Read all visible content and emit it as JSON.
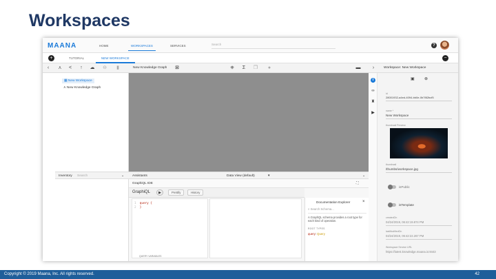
{
  "slide": {
    "title": "Workspaces",
    "footer_copyright": "Copyright © 2019 Maana, Inc.  All rights reserved.",
    "page_number": "42"
  },
  "app": {
    "logo": "MAANA",
    "nav": [
      "HOME",
      "WORKSPACES",
      "SERVICES"
    ],
    "active_nav": "WORKSPACES",
    "search_placeholder": "Search",
    "help_icon": "help-circle-icon"
  },
  "tabs": [
    {
      "label": "TUTORIAL",
      "active": false
    },
    {
      "label": "NEW WORKSPACE",
      "active": true
    }
  ],
  "toolbar": {
    "graph_title": "New Knowledge Graph",
    "panel_title": "Workspace: New Workspace"
  },
  "tree": [
    {
      "label": "New Workspace",
      "selected": true,
      "icon": "workspace-icon"
    },
    {
      "label": "New Knowledge Graph",
      "selected": false,
      "icon": "graph-icon"
    }
  ],
  "inventory": {
    "title": "Inventory",
    "search_placeholder": "Search"
  },
  "assistants": {
    "title": "Assistants",
    "data_view": "Data View (default)"
  },
  "graphiql": {
    "header": "GraphiQL IDE",
    "title": "GraphiQL",
    "prettify": "Prettify",
    "history": "History",
    "code_lines": [
      {
        "num": "1",
        "text": "query {"
      },
      {
        "num": "2",
        "text": "}"
      }
    ],
    "variables_label": "QUERY VARIABLES",
    "docs": {
      "title": "Documentation Explorer",
      "search_placeholder": "Search Schema...",
      "description": "A GraphQL schema provides a root type for each kind of operation.",
      "section": "ROOT TYPES",
      "root_key": "query",
      "root_type": "Query"
    }
  },
  "properties": {
    "id_label": "id",
    "id_value": "28001932-a4ed-4094-bb0e-0b7f82bcf5",
    "name_label": "name *",
    "name_value": "New Workspace",
    "preview_label": "thumbnail Preview",
    "thumbnail_label": "thumbnail",
    "thumbnail_value": "/thumbs/workspace.jpg",
    "is_public_label": "isPublic",
    "is_template_label": "isTemplate",
    "created_label": "createdOn",
    "created_value": "04/24/2019, 06:42:19.874 PM",
    "modified_label": "lastModifiedOn",
    "modified_value": "04/24/2019, 06:42:22.267 PM",
    "service_label": "Workspace Service URL",
    "service_value": "https://latest.knowledge.maana.io:8443"
  },
  "colors": {
    "brand": "#1a7ad9",
    "title": "#1f3864",
    "footer": "#1e5e9a",
    "canvas": "#8e8e8e"
  }
}
